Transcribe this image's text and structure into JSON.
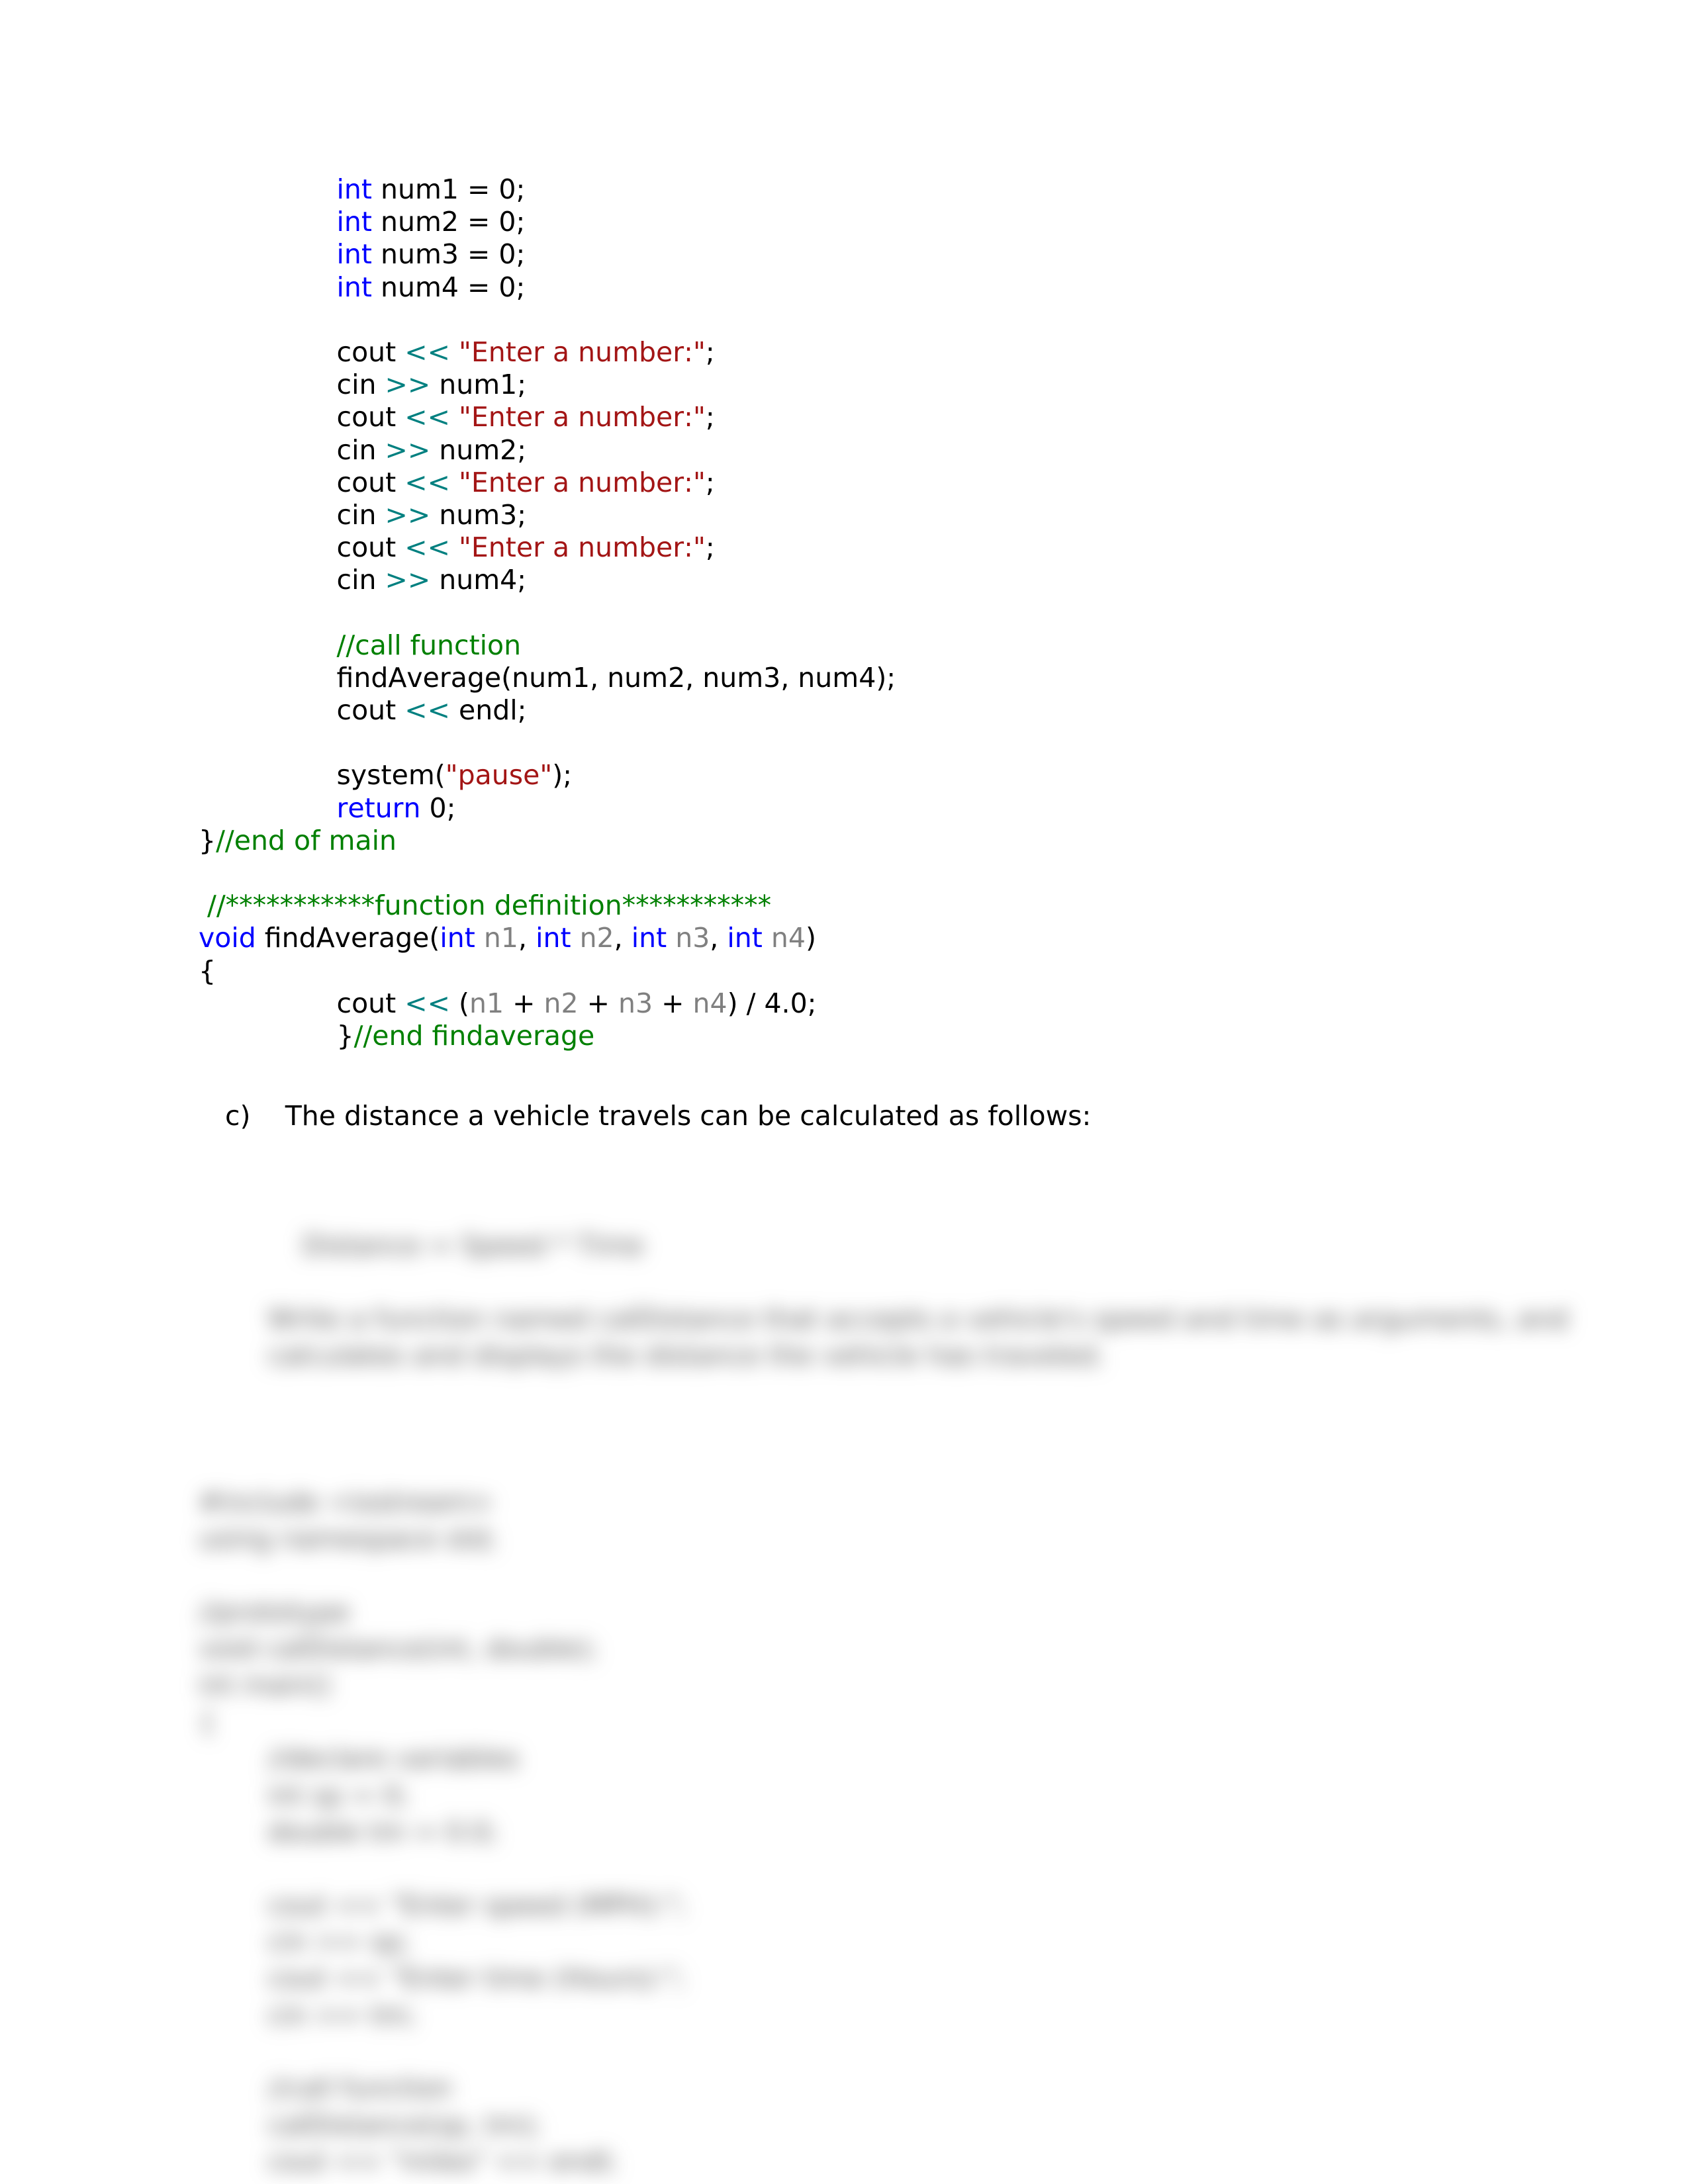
{
  "code": {
    "indent_unit": "        ",
    "lines": [
      {
        "indent": 2,
        "tokens": [
          {
            "cls": "kw",
            "t": "int"
          },
          {
            "cls": "",
            "t": " num1 = 0;"
          }
        ]
      },
      {
        "indent": 2,
        "tokens": [
          {
            "cls": "kw",
            "t": "int"
          },
          {
            "cls": "",
            "t": " num2 = 0;"
          }
        ]
      },
      {
        "indent": 2,
        "tokens": [
          {
            "cls": "kw",
            "t": "int"
          },
          {
            "cls": "",
            "t": " num3 = 0;"
          }
        ]
      },
      {
        "indent": 2,
        "tokens": [
          {
            "cls": "kw",
            "t": "int"
          },
          {
            "cls": "",
            "t": " num4 = 0;"
          }
        ]
      },
      {
        "indent": 0,
        "tokens": [
          {
            "cls": "",
            "t": ""
          }
        ]
      },
      {
        "indent": 2,
        "tokens": [
          {
            "cls": "",
            "t": "cout "
          },
          {
            "cls": "op",
            "t": "<<"
          },
          {
            "cls": "",
            "t": " "
          },
          {
            "cls": "str",
            "t": "\"Enter a number:\""
          },
          {
            "cls": "",
            "t": ";"
          }
        ]
      },
      {
        "indent": 2,
        "tokens": [
          {
            "cls": "",
            "t": "cin "
          },
          {
            "cls": "op",
            "t": ">>"
          },
          {
            "cls": "",
            "t": " num1;"
          }
        ]
      },
      {
        "indent": 2,
        "tokens": [
          {
            "cls": "",
            "t": "cout "
          },
          {
            "cls": "op",
            "t": "<<"
          },
          {
            "cls": "",
            "t": " "
          },
          {
            "cls": "str",
            "t": "\"Enter a number:\""
          },
          {
            "cls": "",
            "t": ";"
          }
        ]
      },
      {
        "indent": 2,
        "tokens": [
          {
            "cls": "",
            "t": "cin "
          },
          {
            "cls": "op",
            "t": ">>"
          },
          {
            "cls": "",
            "t": " num2;"
          }
        ]
      },
      {
        "indent": 2,
        "tokens": [
          {
            "cls": "",
            "t": "cout "
          },
          {
            "cls": "op",
            "t": "<<"
          },
          {
            "cls": "",
            "t": " "
          },
          {
            "cls": "str",
            "t": "\"Enter a number:\""
          },
          {
            "cls": "",
            "t": ";"
          }
        ]
      },
      {
        "indent": 2,
        "tokens": [
          {
            "cls": "",
            "t": "cin "
          },
          {
            "cls": "op",
            "t": ">>"
          },
          {
            "cls": "",
            "t": " num3;"
          }
        ]
      },
      {
        "indent": 2,
        "tokens": [
          {
            "cls": "",
            "t": "cout "
          },
          {
            "cls": "op",
            "t": "<<"
          },
          {
            "cls": "",
            "t": " "
          },
          {
            "cls": "str",
            "t": "\"Enter a number:\""
          },
          {
            "cls": "",
            "t": ";"
          }
        ]
      },
      {
        "indent": 2,
        "tokens": [
          {
            "cls": "",
            "t": "cin "
          },
          {
            "cls": "op",
            "t": ">>"
          },
          {
            "cls": "",
            "t": " num4;"
          }
        ]
      },
      {
        "indent": 0,
        "tokens": [
          {
            "cls": "",
            "t": ""
          }
        ]
      },
      {
        "indent": 2,
        "tokens": [
          {
            "cls": "cmt",
            "t": "//call function"
          }
        ]
      },
      {
        "indent": 2,
        "tokens": [
          {
            "cls": "",
            "t": "findAverage(num1, num2, num3, num4);"
          }
        ]
      },
      {
        "indent": 2,
        "tokens": [
          {
            "cls": "",
            "t": "cout "
          },
          {
            "cls": "op",
            "t": "<<"
          },
          {
            "cls": "",
            "t": " endl;"
          }
        ]
      },
      {
        "indent": 0,
        "tokens": [
          {
            "cls": "",
            "t": ""
          }
        ]
      },
      {
        "indent": 2,
        "tokens": [
          {
            "cls": "",
            "t": "system("
          },
          {
            "cls": "str",
            "t": "\"pause\""
          },
          {
            "cls": "",
            "t": ");"
          }
        ]
      },
      {
        "indent": 2,
        "tokens": [
          {
            "cls": "kw",
            "t": "return"
          },
          {
            "cls": "",
            "t": " 0;"
          }
        ]
      },
      {
        "indent": 0,
        "tokens": [
          {
            "cls": "",
            "t": "}"
          },
          {
            "cls": "cmt",
            "t": "//end of main"
          }
        ]
      },
      {
        "indent": 0,
        "tokens": [
          {
            "cls": "",
            "t": ""
          }
        ]
      },
      {
        "indent": 0,
        "tokens": [
          {
            "cls": "",
            "t": " "
          },
          {
            "cls": "cmt",
            "t": "//***********function definition***********"
          }
        ]
      },
      {
        "indent": 0,
        "tokens": [
          {
            "cls": "kw",
            "t": "void"
          },
          {
            "cls": "",
            "t": " findAverage("
          },
          {
            "cls": "kw",
            "t": "int"
          },
          {
            "cls": "",
            "t": " "
          },
          {
            "cls": "param",
            "t": "n1"
          },
          {
            "cls": "",
            "t": ", "
          },
          {
            "cls": "kw",
            "t": "int"
          },
          {
            "cls": "",
            "t": " "
          },
          {
            "cls": "param",
            "t": "n2"
          },
          {
            "cls": "",
            "t": ", "
          },
          {
            "cls": "kw",
            "t": "int"
          },
          {
            "cls": "",
            "t": " "
          },
          {
            "cls": "param",
            "t": "n3"
          },
          {
            "cls": "",
            "t": ", "
          },
          {
            "cls": "kw",
            "t": "int"
          },
          {
            "cls": "",
            "t": " "
          },
          {
            "cls": "param",
            "t": "n4"
          },
          {
            "cls": "",
            "t": ")"
          }
        ]
      },
      {
        "indent": 0,
        "tokens": [
          {
            "cls": "",
            "t": "{"
          }
        ]
      },
      {
        "indent": 2,
        "tokens": [
          {
            "cls": "",
            "t": "cout "
          },
          {
            "cls": "op",
            "t": "<<"
          },
          {
            "cls": "",
            "t": " ("
          },
          {
            "cls": "param",
            "t": "n1"
          },
          {
            "cls": "",
            "t": " + "
          },
          {
            "cls": "param",
            "t": "n2"
          },
          {
            "cls": "",
            "t": " + "
          },
          {
            "cls": "param",
            "t": "n3"
          },
          {
            "cls": "",
            "t": " + "
          },
          {
            "cls": "param",
            "t": "n4"
          },
          {
            "cls": "",
            "t": ") / 4.0;"
          }
        ]
      },
      {
        "indent": 2,
        "tokens": [
          {
            "cls": "",
            "t": "}"
          },
          {
            "cls": "cmt",
            "t": "//end findaverage"
          }
        ]
      }
    ]
  },
  "question": {
    "label": "c)",
    "gap": "    ",
    "text": "The distance a vehicle travels can be calculated as follows:"
  },
  "blurred_hint": "        Distance = Speed * Time\n\n        Write a function named calDistance that accepts a vehicle's speed and time as arguments, and\n        calculates and displays the distance the vehicle has traveled.\n\n\n\n#include <iostream>\nusing namespace std;\n\n//prototype\nvoid calDistance(int, double);\nint main()\n{\n        //declare variables\n        int sp = 0;\n        double tm = 0.0;\n\n        cout << \"Enter speed (MPH):\";\n        cin >> sp;\n        cout << \"Enter time (Hours):\";\n        cin >> tm;\n\n        //call function\n        calDistance(sp, tm);\n        cout << \"miles\" << endl;"
}
